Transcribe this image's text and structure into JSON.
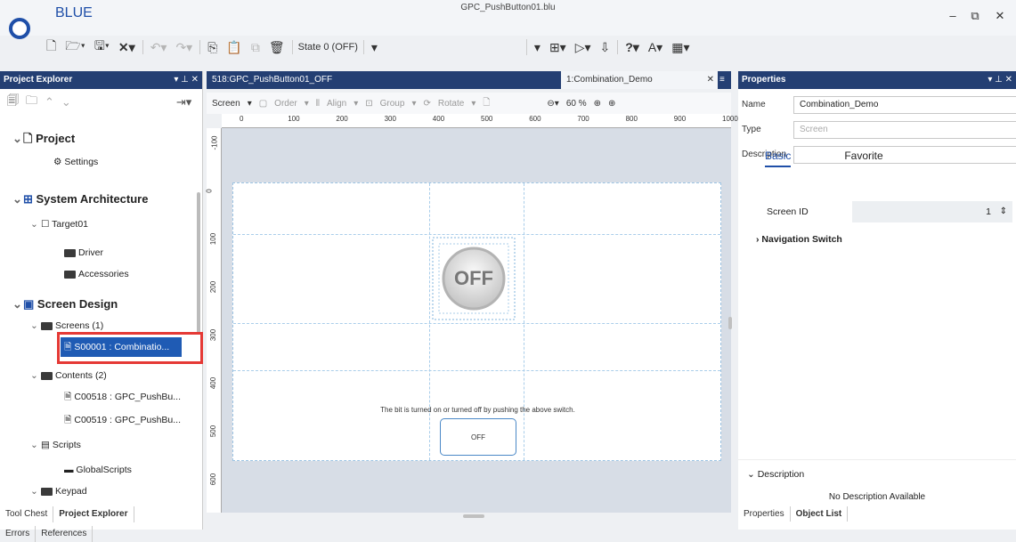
{
  "window": {
    "app_name": "BLUE",
    "doc_title": "GPC_PushButton01.blu",
    "min": "–",
    "restore": "⧉",
    "close": "✕"
  },
  "toolbar": {
    "state_label": "State 0 (OFF)"
  },
  "project_explorer": {
    "title": "Project Explorer",
    "controls": "▾ ⊥ ✕",
    "tree": {
      "project": "Project",
      "settings": "Settings",
      "system_architecture": "System Architecture",
      "target": "Target01",
      "driver": "Driver",
      "accessories": "Accessories",
      "screen_design": "Screen Design",
      "screens": "Screens (1)",
      "screen_item": "S00001 : Combinatio...",
      "contents": "Contents (2)",
      "content1": "C00518 : GPC_PushBu...",
      "content2": "C00519 : GPC_PushBu...",
      "scripts": "Scripts",
      "global_scripts": "GlobalScripts",
      "keypad": "Keypad"
    },
    "bottom_tabs": [
      "Tool Chest",
      "Project Explorer"
    ],
    "bottom_tabs_active": "Project Explorer"
  },
  "bottom_bar": [
    "Errors",
    "References"
  ],
  "editor": {
    "tab1": "518:GPC_PushButton01_OFF",
    "tab2": "1:Combination_Demo",
    "toolbar": {
      "screen": "Screen",
      "order": "Order",
      "align": "Align",
      "group": "Group",
      "rotate": "Rotate",
      "zoom": "60 %"
    },
    "ruler_h": [
      "0",
      "100",
      "200",
      "300",
      "400",
      "500",
      "600",
      "700",
      "800",
      "900",
      "1000"
    ],
    "ruler_v": [
      "-100",
      "0",
      "100",
      "200",
      "300",
      "400",
      "500",
      "600"
    ],
    "big_button_text": "OFF",
    "caption": "The bit is turned on or turned off by pushing the above switch.",
    "small_button_text": "OFF"
  },
  "properties": {
    "title": "Properties",
    "name_label": "Name",
    "name_value": "Combination_Demo",
    "type_label": "Type",
    "type_value": "Screen",
    "description_label": "Description",
    "description_value": "",
    "subtabs": [
      "Basic",
      "Favorite"
    ],
    "screen_id_label": "Screen ID",
    "screen_id_value": "1",
    "navigation_switch": "Navigation Switch",
    "desc_section": "Description",
    "no_desc": "No Description Available",
    "bottom_tabs": [
      "Properties",
      "Object List"
    ]
  },
  "colors": {
    "panel_header": "#243f73",
    "selection": "#1f5bb4",
    "highlight": "#e53935",
    "brand": "#1f4fa8"
  }
}
